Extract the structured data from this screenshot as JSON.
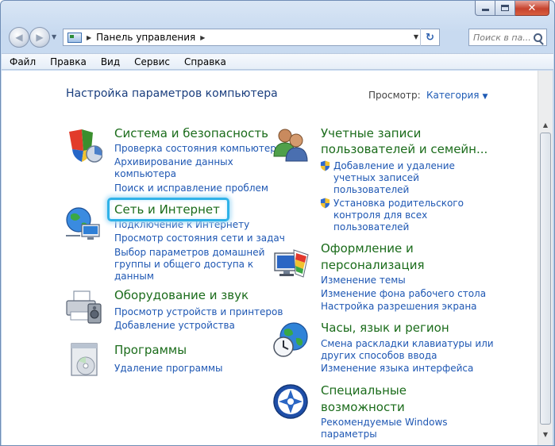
{
  "window": {
    "caption_buttons": {
      "minimize": "–",
      "maximize": "□",
      "close": "✕"
    }
  },
  "nav": {
    "back_icon": "back-arrow-icon",
    "forward_icon": "forward-arrow-icon",
    "address_breadcrumb": "Панель управления",
    "search_placeholder": "Поиск в па..."
  },
  "menu": [
    "Файл",
    "Правка",
    "Вид",
    "Сервис",
    "Справка"
  ],
  "content": {
    "heading": "Настройка параметров компьютера",
    "view_label": "Просмотр:",
    "view_value": "Категория",
    "categories": [
      {
        "title": "Система и безопасность",
        "icon": "shield-icon",
        "links": [
          "Проверка состояния компьютера",
          "Архивирование данных",
          "компьютера",
          "Поиск и исправление проблем"
        ]
      },
      {
        "title": "Сеть и Интернет",
        "icon": "network-icon",
        "links": [
          "Подключение к Интернету",
          "Просмотр состояния сети и задач",
          "Выбор параметров домашней",
          "группы и общего доступа к",
          "данным"
        ]
      },
      {
        "title": "Оборудование и звук",
        "icon": "printer-icon",
        "links": [
          "Просмотр устройств и принтеров",
          "Добавление устройства"
        ]
      },
      {
        "title": "Программы",
        "icon": "programs-icon",
        "links": [
          "Удаление программы"
        ]
      },
      {
        "title_lines": [
          "Учетные записи",
          "пользователей и семейн..."
        ],
        "icon": "users-icon",
        "links": [
          "Добавление и удаление",
          "учетных записей",
          "пользователей",
          "Установка родительского",
          "контроля для всех",
          "пользователей"
        ]
      },
      {
        "title_lines": [
          "Оформление и",
          "персонализация"
        ],
        "icon": "appearance-icon",
        "links": [
          "Изменение темы",
          "Изменение фона рабочего стола",
          "Настройка разрешения экрана"
        ]
      },
      {
        "title": "Часы, язык и регион",
        "icon": "clock-globe-icon",
        "links": [
          "Смена раскладки клавиатуры или",
          "других способов ввода",
          "Изменение языка интерфейса"
        ]
      },
      {
        "title_lines": [
          "Специальные",
          "возможности"
        ],
        "icon": "accessibility-icon",
        "links": [
          "Рекомендуемые Windows",
          "параметры"
        ]
      }
    ]
  },
  "colors": {
    "category_title": "#1b6c1b",
    "link": "#1e57b3",
    "heading": "#1a3e7e",
    "highlight": "#2fb2e8"
  }
}
